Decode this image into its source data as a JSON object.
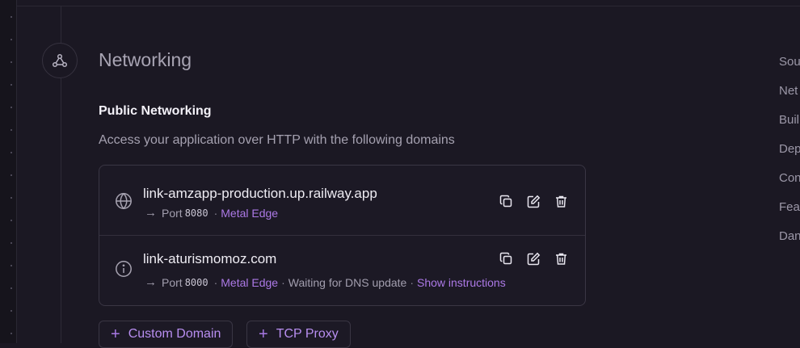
{
  "section": {
    "title": "Networking",
    "icon": "network-nodes-icon"
  },
  "public_networking": {
    "title": "Public Networking",
    "description": "Access your application over HTTP with the following domains",
    "domains": [
      {
        "name": "link-amzapp-production.up.railway.app",
        "icon": "globe-icon",
        "port_label": "Port",
        "port": "8080",
        "edge": "Metal Edge"
      },
      {
        "name": "link-aturismomoz.com",
        "icon": "info-icon",
        "port_label": "Port",
        "port": "8000",
        "edge": "Metal Edge",
        "status": "Waiting for DNS update",
        "instructions_link": "Show instructions"
      }
    ],
    "add_buttons": {
      "custom_domain": "Custom Domain",
      "tcp_proxy": "TCP Proxy"
    }
  },
  "right_nav": [
    "Sou",
    "Net",
    "Buil",
    "Dep",
    "Con",
    "Fea",
    "Dan"
  ],
  "colors": {
    "background": "#1b1823",
    "accent": "#ac79e6",
    "border": "#3a3644"
  }
}
